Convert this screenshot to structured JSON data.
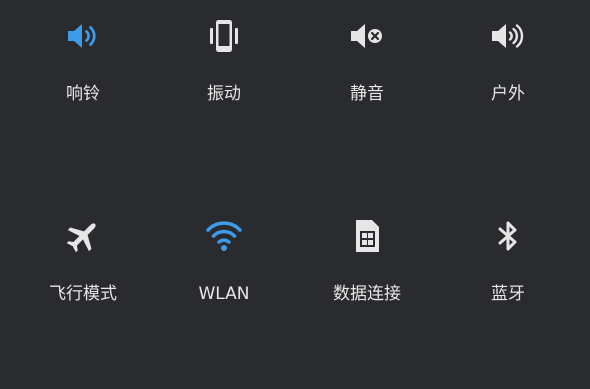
{
  "sound_modes": [
    {
      "label": "响铃",
      "icon": "volume-ring-icon",
      "active": true
    },
    {
      "label": "振动",
      "icon": "phone-vibrate-icon",
      "active": false
    },
    {
      "label": "静音",
      "icon": "volume-mute-icon",
      "active": false
    },
    {
      "label": "户外",
      "icon": "volume-loud-icon",
      "active": false
    }
  ],
  "toggles": [
    {
      "label": "飞行模式",
      "icon": "airplane-icon",
      "active": false
    },
    {
      "label": "WLAN",
      "icon": "wifi-icon",
      "active": true
    },
    {
      "label": "数据连接",
      "icon": "sim-card-icon",
      "active": false
    },
    {
      "label": "蓝牙",
      "icon": "bluetooth-icon",
      "active": false
    }
  ],
  "colors": {
    "background": "#2a2b2e",
    "active": "#3d9be9",
    "inactive": "#e6e6e6",
    "label": "#e6e6e6"
  }
}
